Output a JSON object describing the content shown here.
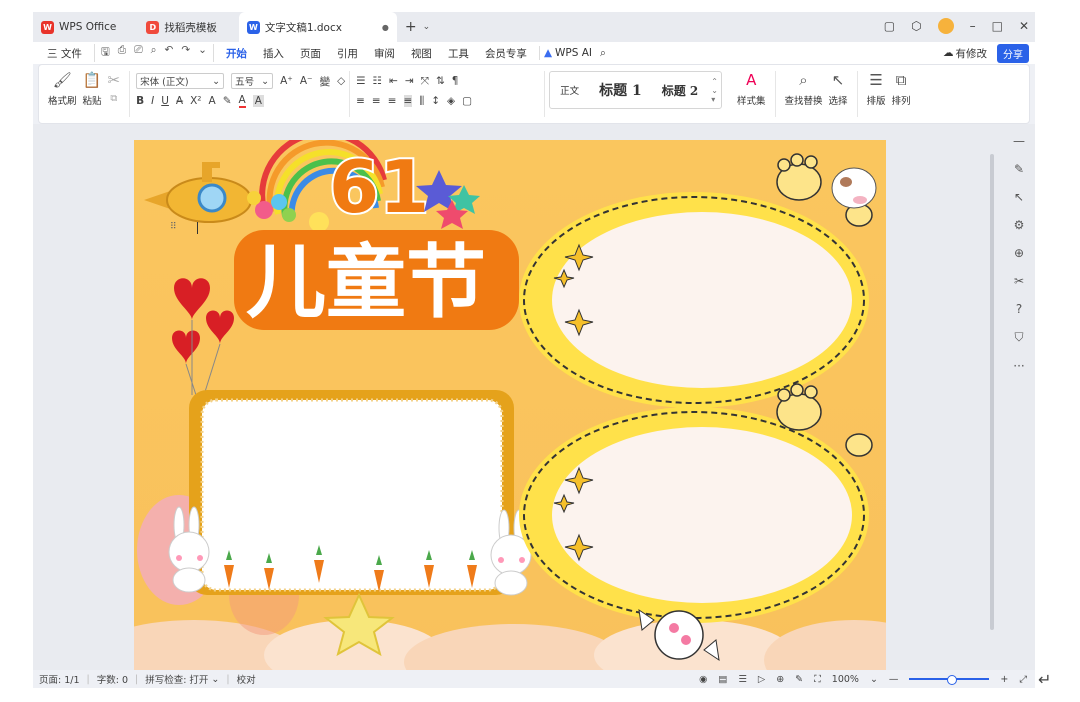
{
  "tabs": [
    {
      "label": "WPS Office",
      "icon": "wps-logo-icon",
      "color": "#e8332a"
    },
    {
      "label": "找稻壳模板",
      "icon": "docer-icon",
      "color": "#f04a3c"
    },
    {
      "label": "文字文稿1.docx",
      "icon": "writer-doc-icon",
      "color": "#2b62e8",
      "active": true
    }
  ],
  "menu": {
    "file": "三 文件",
    "items": [
      "开始",
      "插入",
      "页面",
      "引用",
      "审阅",
      "视图",
      "工具",
      "会员专享"
    ],
    "active": "开始",
    "ai": "WPS AI",
    "revise": "有修改",
    "share": "分享"
  },
  "ribbon": {
    "format_painter": "格式刷",
    "paste": "粘贴",
    "font_name": "宋体 (正文)",
    "font_size": "五号",
    "styles": [
      "正文",
      "标题 1",
      "标题 2"
    ],
    "style_set": "样式集",
    "find_replace": "查找替换",
    "select": "选择",
    "layout": "排版",
    "arrange": "排列"
  },
  "document": {
    "title_number": "61",
    "title_text": "儿童节"
  },
  "status": {
    "page": "页面: 1/1",
    "words": "字数: 0",
    "spellcheck": "拼写检查: 打开",
    "proofread": "校对",
    "zoom": "100%"
  },
  "colors": {
    "accent": "#2b62e8",
    "page_bg": "#fac65e",
    "title_orange": "#f07a12"
  }
}
